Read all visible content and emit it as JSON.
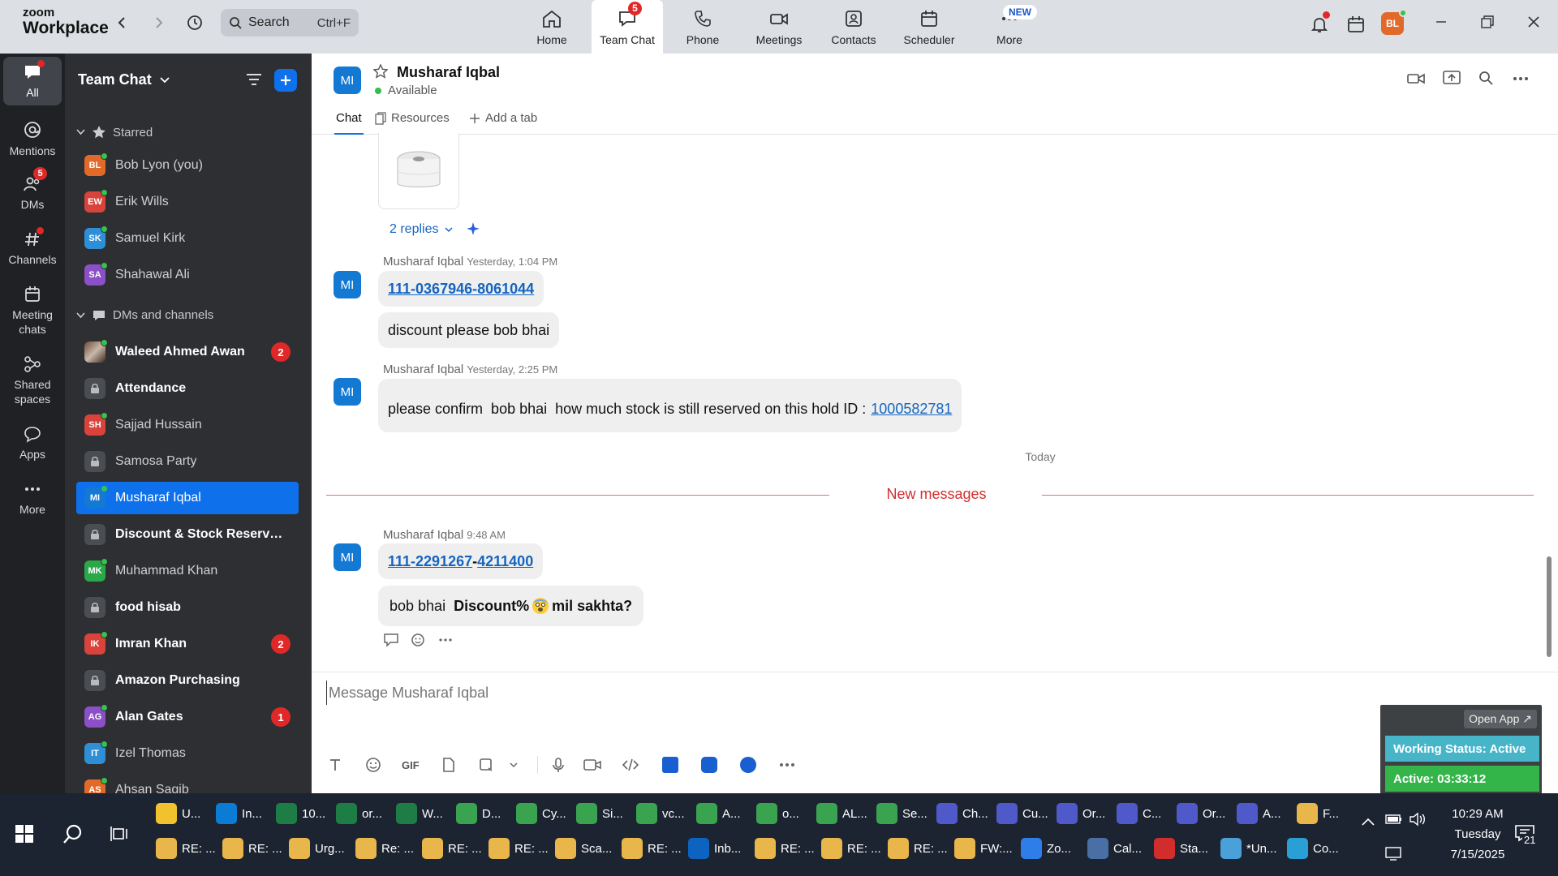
{
  "app": {
    "logo_top": "zoom",
    "logo_bottom": "Workplace"
  },
  "topbar": {
    "search_label": "Search",
    "search_shortcut": "Ctrl+F",
    "tabs": [
      {
        "label": "Home"
      },
      {
        "label": "Team Chat",
        "badge": "5"
      },
      {
        "label": "Phone"
      },
      {
        "label": "Meetings"
      },
      {
        "label": "Contacts"
      },
      {
        "label": "Scheduler"
      },
      {
        "label": "More",
        "badge": "NEW"
      }
    ],
    "user_initials": "BL"
  },
  "rail": {
    "items": [
      {
        "label": "All"
      },
      {
        "label": "Mentions"
      },
      {
        "label": "DMs",
        "badge": "5"
      },
      {
        "label": "Channels"
      },
      {
        "label": "Meeting chats"
      },
      {
        "label": "Shared spaces"
      },
      {
        "label": "Apps"
      },
      {
        "label": "More"
      }
    ]
  },
  "sidebar": {
    "title": "Team Chat",
    "starred_label": "Starred",
    "starred": [
      {
        "name": "Bob Lyon (you)",
        "initials": "BL",
        "color": "#e1692a"
      },
      {
        "name": "Erik Wills",
        "initials": "EW",
        "color": "#d9433c"
      },
      {
        "name": "Samuel Kirk",
        "initials": "SK",
        "color": "#2f8fd6"
      },
      {
        "name": "Shahawal Ali",
        "initials": "SA",
        "color": "#8b4fc7"
      }
    ],
    "dms_label": "DMs and channels",
    "items": [
      {
        "name": "Waleed Ahmed Awan",
        "type": "photo",
        "bold": true,
        "count": "2"
      },
      {
        "name": "Attendance",
        "type": "lock",
        "bold": true
      },
      {
        "name": "Sajjad Hussain",
        "initials": "SH",
        "color": "#d9433c"
      },
      {
        "name": "Samosa Party",
        "type": "lock"
      },
      {
        "name": "Musharaf Iqbal",
        "initials": "MI",
        "color": "#1479d3",
        "selected": true
      },
      {
        "name": "Discount & Stock Reserva...",
        "type": "lock",
        "bold": true
      },
      {
        "name": "Muhammad Khan",
        "initials": "MK",
        "color": "#2aa84a"
      },
      {
        "name": "food hisab",
        "type": "lock",
        "bold": true
      },
      {
        "name": "Imran Khan",
        "initials": "IK",
        "color": "#d9433c",
        "bold": true,
        "count": "2"
      },
      {
        "name": "Amazon Purchasing",
        "type": "lock",
        "bold": true
      },
      {
        "name": "Alan Gates",
        "initials": "AG",
        "color": "#8b4fc7",
        "bold": true,
        "count": "1"
      },
      {
        "name": "Izel Thomas",
        "initials": "IT",
        "color": "#2f8fd6"
      },
      {
        "name": "Ahsan Saqib",
        "initials": "AS",
        "color": "#e1692a"
      }
    ]
  },
  "chat": {
    "contact_initials": "MI",
    "contact_name": "Musharaf Iqbal",
    "status": "Available",
    "tabs": {
      "chat": "Chat",
      "resources": "Resources",
      "add": "Add a tab"
    },
    "replies": "2 replies",
    "messages": [
      {
        "author": "Musharaf Iqbal",
        "time": "Yesterday, 1:04 PM",
        "phone": "111-0367946-8061044",
        "text": "discount please bob bhai"
      },
      {
        "author": "Musharaf Iqbal",
        "time": "Yesterday, 2:25 PM",
        "text": "please confirm  bob bhai  how much stock is still reserved on this hold ID :",
        "link": "1000582781"
      },
      {
        "author": "Musharaf Iqbal",
        "time": "9:48 AM",
        "phone_a": "111-2291267",
        "phone_sep": "-",
        "phone_b": "4211400",
        "text_a": "bob bhai",
        "text_b": "Discount%",
        "text_c": "mil sakhta?"
      }
    ],
    "divider_today": "Today",
    "divider_new": "New messages",
    "composer_placeholder": "Message Musharaf Iqbal"
  },
  "working_status": {
    "open_app": "Open App ↗",
    "status": "Working Status: Active",
    "timer": "Active: 03:33:12"
  },
  "taskbar": {
    "row1": [
      {
        "label": "U...",
        "color": "#f2c12e"
      },
      {
        "label": "In...",
        "color": "#0c7bd6"
      },
      {
        "label": "10...",
        "color": "#1e7d45"
      },
      {
        "label": "or...",
        "color": "#1e7d45"
      },
      {
        "label": "W...",
        "color": "#1e7d45"
      },
      {
        "label": "D...",
        "color": "#3aa34f"
      },
      {
        "label": "Cy...",
        "color": "#3aa34f"
      },
      {
        "label": "Si...",
        "color": "#3aa34f"
      },
      {
        "label": "vc...",
        "color": "#3aa34f"
      },
      {
        "label": "A...",
        "color": "#3aa34f"
      },
      {
        "label": "o...",
        "color": "#3aa34f"
      },
      {
        "label": "AL...",
        "color": "#3aa34f"
      },
      {
        "label": "Se...",
        "color": "#3aa34f"
      },
      {
        "label": "Ch...",
        "color": "#5059c9"
      },
      {
        "label": "Cu...",
        "color": "#5059c9"
      },
      {
        "label": "Or...",
        "color": "#5059c9"
      },
      {
        "label": "C...",
        "color": "#5059c9"
      },
      {
        "label": "Or...",
        "color": "#5059c9"
      },
      {
        "label": "A...",
        "color": "#5059c9"
      },
      {
        "label": "F...",
        "color": "#e8b64a"
      }
    ],
    "row2": [
      {
        "label": "RE: ...",
        "color": "#e8b64a"
      },
      {
        "label": "RE: ...",
        "color": "#e8b64a"
      },
      {
        "label": "Urg...",
        "color": "#e8b64a"
      },
      {
        "label": "Re: ...",
        "color": "#e8b64a"
      },
      {
        "label": "RE: ...",
        "color": "#e8b64a"
      },
      {
        "label": "RE: ...",
        "color": "#e8b64a"
      },
      {
        "label": "Sca...",
        "color": "#e8b64a"
      },
      {
        "label": "RE: ...",
        "color": "#e8b64a"
      },
      {
        "label": "Inb...",
        "color": "#0c64c0"
      },
      {
        "label": "RE: ...",
        "color": "#e8b64a"
      },
      {
        "label": "RE: ...",
        "color": "#e8b64a"
      },
      {
        "label": "RE: ...",
        "color": "#e8b64a"
      },
      {
        "label": "FW:...",
        "color": "#e8b64a"
      },
      {
        "label": "Zo...",
        "color": "#2d7ee8"
      },
      {
        "label": "Cal...",
        "color": "#4a6fa5"
      },
      {
        "label": "Sta...",
        "color": "#d22d2d"
      },
      {
        "label": "*Un...",
        "color": "#4aa0d8"
      },
      {
        "label": "Co...",
        "color": "#2a9fd6"
      }
    ],
    "time": "10:29 AM",
    "day": "Tuesday",
    "date": "7/15/2025",
    "notifications": "21"
  }
}
